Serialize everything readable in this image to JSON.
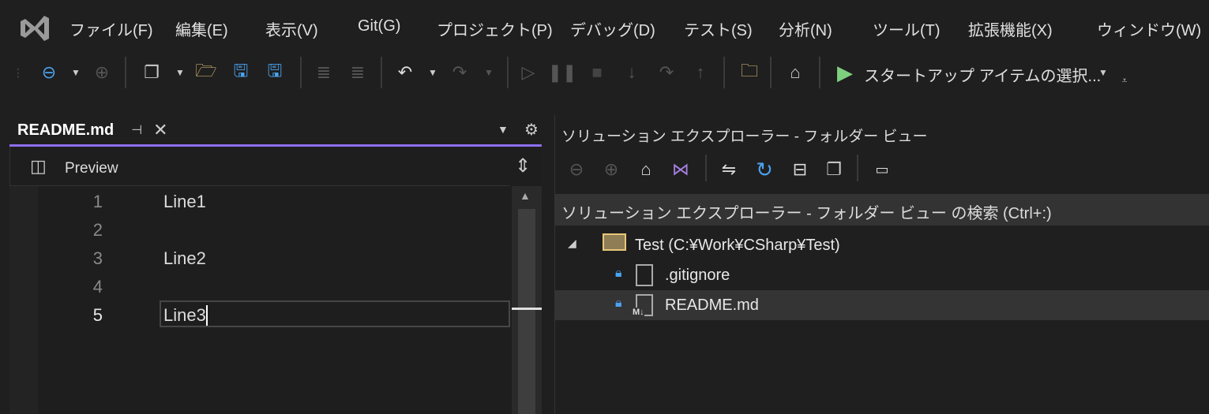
{
  "menu": [
    "ファイル(F)",
    "編集(E)",
    "表示(V)",
    "Git(G)",
    "プロジェクト(P)",
    "デバッグ(D)",
    "テスト(S)",
    "分析(N)",
    "ツール(T)",
    "拡張機能(X)",
    "ウィンドウ(W)"
  ],
  "toolbar": {
    "startup_label": "スタートアップ アイテムの選択..."
  },
  "editor": {
    "tab_title": "README.md",
    "preview_label": "Preview",
    "lines": [
      {
        "num": "1",
        "text": "Line1"
      },
      {
        "num": "2",
        "text": ""
      },
      {
        "num": "3",
        "text": "Line2"
      },
      {
        "num": "4",
        "text": ""
      },
      {
        "num": "5",
        "text": "Line3"
      }
    ]
  },
  "solution_explorer": {
    "title": "ソリューション エクスプローラー - フォルダー ビュー",
    "search_placeholder": "ソリューション エクスプローラー - フォルダー ビュー の検索 (Ctrl+:)",
    "root": "Test (C:¥Work¥CSharp¥Test)",
    "files": [
      ".gitignore",
      "README.md"
    ],
    "md_badge": "M↓"
  },
  "colors": {
    "accent": "#8c6ff0",
    "blue": "#4aa3f0",
    "folder": "#e8c77a",
    "play": "#7ed07e"
  }
}
